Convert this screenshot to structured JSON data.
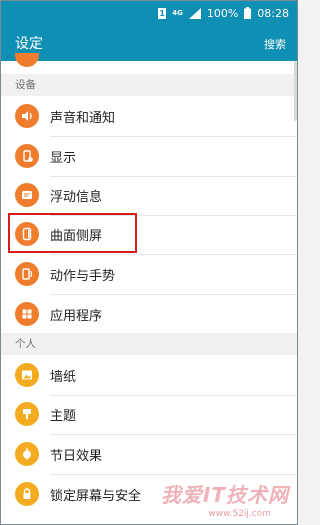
{
  "status_bar": {
    "sim": "1",
    "network": "4G",
    "battery": "100%",
    "time": "08:28"
  },
  "app_bar": {
    "title": "设定",
    "search_label": "搜索"
  },
  "sections": {
    "device": "设备",
    "personal": "个人"
  },
  "items": {
    "sound": "声音和通知",
    "display": "显示",
    "floating": "浮动信息",
    "edge": "曲面侧屏",
    "motion": "动作与手势",
    "apps": "应用程序",
    "wallpaper": "墙纸",
    "theme": "主题",
    "holiday": "节日效果",
    "lockscreen": "锁定屏幕与安全"
  },
  "watermark": {
    "text": "我爱IT技术网",
    "url": "www.52ij.com"
  },
  "colors": {
    "header": "#0f8fb3",
    "icon_orange": "#f07d2e",
    "icon_yellow": "#f3ac22",
    "highlight": "#d61b1b"
  }
}
